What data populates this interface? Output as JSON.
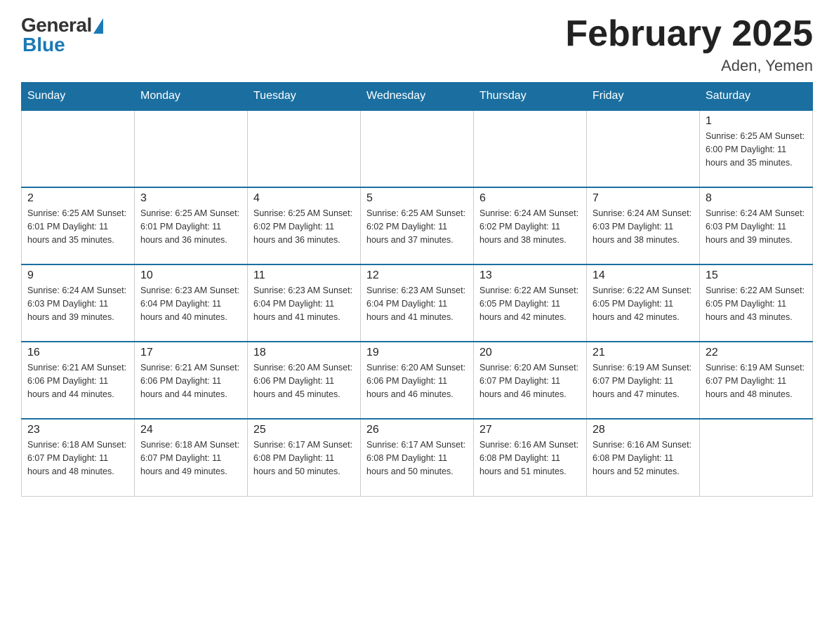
{
  "header": {
    "logo": {
      "general": "General",
      "blue": "Blue"
    },
    "title": "February 2025",
    "location": "Aden, Yemen"
  },
  "days_of_week": [
    "Sunday",
    "Monday",
    "Tuesday",
    "Wednesday",
    "Thursday",
    "Friday",
    "Saturday"
  ],
  "weeks": [
    [
      {
        "day": "",
        "info": ""
      },
      {
        "day": "",
        "info": ""
      },
      {
        "day": "",
        "info": ""
      },
      {
        "day": "",
        "info": ""
      },
      {
        "day": "",
        "info": ""
      },
      {
        "day": "",
        "info": ""
      },
      {
        "day": "1",
        "info": "Sunrise: 6:25 AM\nSunset: 6:00 PM\nDaylight: 11 hours\nand 35 minutes."
      }
    ],
    [
      {
        "day": "2",
        "info": "Sunrise: 6:25 AM\nSunset: 6:01 PM\nDaylight: 11 hours\nand 35 minutes."
      },
      {
        "day": "3",
        "info": "Sunrise: 6:25 AM\nSunset: 6:01 PM\nDaylight: 11 hours\nand 36 minutes."
      },
      {
        "day": "4",
        "info": "Sunrise: 6:25 AM\nSunset: 6:02 PM\nDaylight: 11 hours\nand 36 minutes."
      },
      {
        "day": "5",
        "info": "Sunrise: 6:25 AM\nSunset: 6:02 PM\nDaylight: 11 hours\nand 37 minutes."
      },
      {
        "day": "6",
        "info": "Sunrise: 6:24 AM\nSunset: 6:02 PM\nDaylight: 11 hours\nand 38 minutes."
      },
      {
        "day": "7",
        "info": "Sunrise: 6:24 AM\nSunset: 6:03 PM\nDaylight: 11 hours\nand 38 minutes."
      },
      {
        "day": "8",
        "info": "Sunrise: 6:24 AM\nSunset: 6:03 PM\nDaylight: 11 hours\nand 39 minutes."
      }
    ],
    [
      {
        "day": "9",
        "info": "Sunrise: 6:24 AM\nSunset: 6:03 PM\nDaylight: 11 hours\nand 39 minutes."
      },
      {
        "day": "10",
        "info": "Sunrise: 6:23 AM\nSunset: 6:04 PM\nDaylight: 11 hours\nand 40 minutes."
      },
      {
        "day": "11",
        "info": "Sunrise: 6:23 AM\nSunset: 6:04 PM\nDaylight: 11 hours\nand 41 minutes."
      },
      {
        "day": "12",
        "info": "Sunrise: 6:23 AM\nSunset: 6:04 PM\nDaylight: 11 hours\nand 41 minutes."
      },
      {
        "day": "13",
        "info": "Sunrise: 6:22 AM\nSunset: 6:05 PM\nDaylight: 11 hours\nand 42 minutes."
      },
      {
        "day": "14",
        "info": "Sunrise: 6:22 AM\nSunset: 6:05 PM\nDaylight: 11 hours\nand 42 minutes."
      },
      {
        "day": "15",
        "info": "Sunrise: 6:22 AM\nSunset: 6:05 PM\nDaylight: 11 hours\nand 43 minutes."
      }
    ],
    [
      {
        "day": "16",
        "info": "Sunrise: 6:21 AM\nSunset: 6:06 PM\nDaylight: 11 hours\nand 44 minutes."
      },
      {
        "day": "17",
        "info": "Sunrise: 6:21 AM\nSunset: 6:06 PM\nDaylight: 11 hours\nand 44 minutes."
      },
      {
        "day": "18",
        "info": "Sunrise: 6:20 AM\nSunset: 6:06 PM\nDaylight: 11 hours\nand 45 minutes."
      },
      {
        "day": "19",
        "info": "Sunrise: 6:20 AM\nSunset: 6:06 PM\nDaylight: 11 hours\nand 46 minutes."
      },
      {
        "day": "20",
        "info": "Sunrise: 6:20 AM\nSunset: 6:07 PM\nDaylight: 11 hours\nand 46 minutes."
      },
      {
        "day": "21",
        "info": "Sunrise: 6:19 AM\nSunset: 6:07 PM\nDaylight: 11 hours\nand 47 minutes."
      },
      {
        "day": "22",
        "info": "Sunrise: 6:19 AM\nSunset: 6:07 PM\nDaylight: 11 hours\nand 48 minutes."
      }
    ],
    [
      {
        "day": "23",
        "info": "Sunrise: 6:18 AM\nSunset: 6:07 PM\nDaylight: 11 hours\nand 48 minutes."
      },
      {
        "day": "24",
        "info": "Sunrise: 6:18 AM\nSunset: 6:07 PM\nDaylight: 11 hours\nand 49 minutes."
      },
      {
        "day": "25",
        "info": "Sunrise: 6:17 AM\nSunset: 6:08 PM\nDaylight: 11 hours\nand 50 minutes."
      },
      {
        "day": "26",
        "info": "Sunrise: 6:17 AM\nSunset: 6:08 PM\nDaylight: 11 hours\nand 50 minutes."
      },
      {
        "day": "27",
        "info": "Sunrise: 6:16 AM\nSunset: 6:08 PM\nDaylight: 11 hours\nand 51 minutes."
      },
      {
        "day": "28",
        "info": "Sunrise: 6:16 AM\nSunset: 6:08 PM\nDaylight: 11 hours\nand 52 minutes."
      },
      {
        "day": "",
        "info": ""
      }
    ]
  ]
}
